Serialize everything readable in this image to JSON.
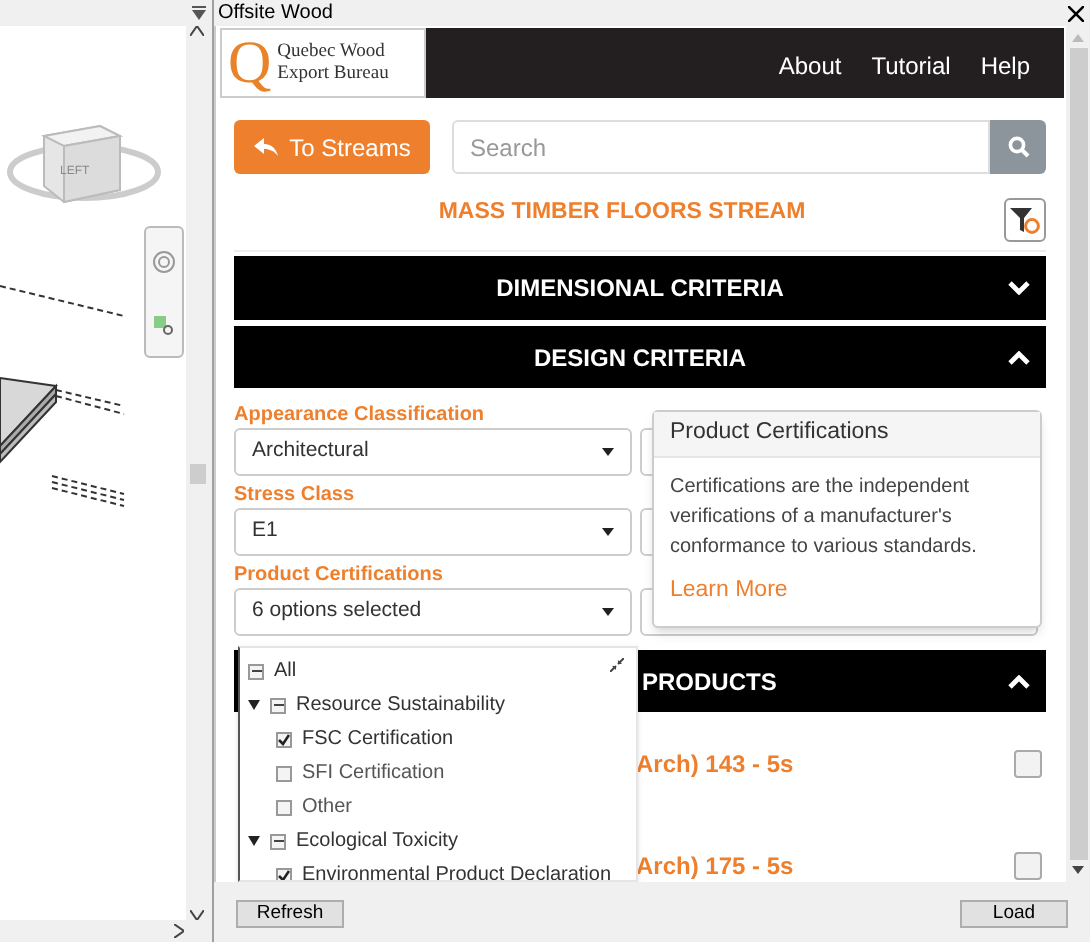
{
  "model_view": {
    "viewcube_label": "LEFT"
  },
  "panel": {
    "title": "Offsite Wood",
    "logo": {
      "letter": "Q",
      "line_1": "Quebec Wood",
      "line_2": "Export Bureau"
    },
    "nav": [
      "About",
      "Tutorial",
      "Help"
    ],
    "back_button": "To Streams",
    "search": {
      "placeholder": "Search"
    },
    "stream_title": "MASS TIMBER FLOORS STREAM",
    "sections": [
      {
        "title": "DIMENSIONAL CRITERIA",
        "expanded": false
      },
      {
        "title": "DESIGN CRITERIA",
        "expanded": true
      }
    ],
    "fields": [
      {
        "label": "Appearance Classification",
        "value": "Architectural"
      },
      {
        "label": "Stress Class",
        "value": "E1"
      },
      {
        "label": "Product Certifications",
        "value": "6 options selected"
      }
    ],
    "popover": {
      "title": "Product Certifications",
      "body": "Certifications are the independent verifications of a manufacturer's conformance to various standards.",
      "link": "Learn More"
    },
    "options": [
      {
        "label": "All",
        "partial": true,
        "children": [
          {
            "label": "Resource Sustainability",
            "partial": true,
            "expanded": true,
            "children": [
              {
                "label": "FSC Certification",
                "checked": true
              },
              {
                "label": "SFI Certification",
                "checked": false
              },
              {
                "label": "Other",
                "checked": false
              }
            ]
          },
          {
            "label": "Ecological Toxicity",
            "partial": true,
            "expanded": true,
            "children": [
              {
                "label": "Environmental Product Declaration",
                "checked": true
              }
            ]
          }
        ]
      }
    ],
    "products": {
      "title": "PRODUCTS",
      "expanded": true,
      "items": [
        {
          "name": "Arch) 143 - 5s",
          "checked": false
        },
        {
          "name": "Arch) 175 - 5s",
          "checked": false
        }
      ]
    },
    "footer_buttons": [
      "Refresh",
      "Load"
    ]
  }
}
